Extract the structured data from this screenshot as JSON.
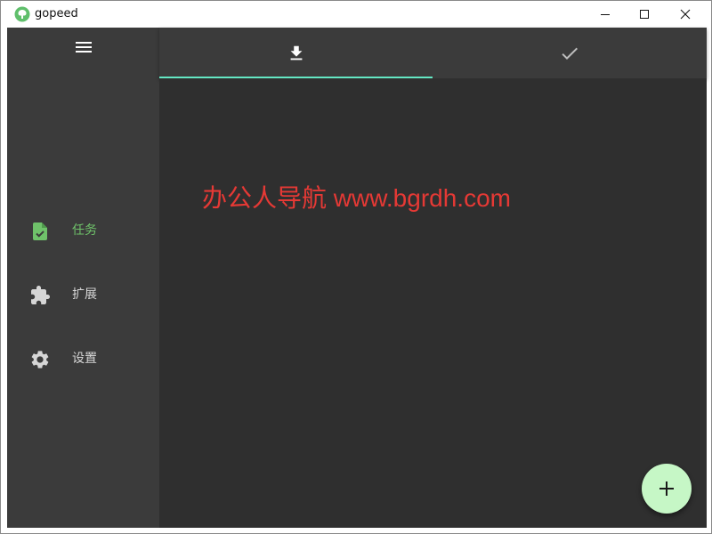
{
  "window": {
    "title": "gopeed",
    "icon": "gopeed-logo-icon",
    "controls": [
      "minimize-icon",
      "maximize-icon",
      "close-icon"
    ]
  },
  "sidebar": {
    "menu_icon": "hamburger-menu-icon",
    "items": [
      {
        "label": "任务",
        "icon": "task-file-icon",
        "active": true
      },
      {
        "label": "扩展",
        "icon": "puzzle-extension-icon",
        "active": false
      },
      {
        "label": "设置",
        "icon": "gear-icon",
        "active": false
      }
    ]
  },
  "tabs": [
    {
      "icon": "download-icon",
      "active": true
    },
    {
      "icon": "check-icon",
      "active": false
    }
  ],
  "content": {
    "watermark": "办公人导航 www.bgrdh.com"
  },
  "fab": {
    "icon": "plus-icon"
  },
  "colors": {
    "accent": "#64e8c4",
    "active_nav": "#6fc26a",
    "fab": "#c6f7c6",
    "sidebar_bg": "#3b3b3b",
    "content_bg": "#2f2f2f",
    "watermark": "#e53935"
  }
}
